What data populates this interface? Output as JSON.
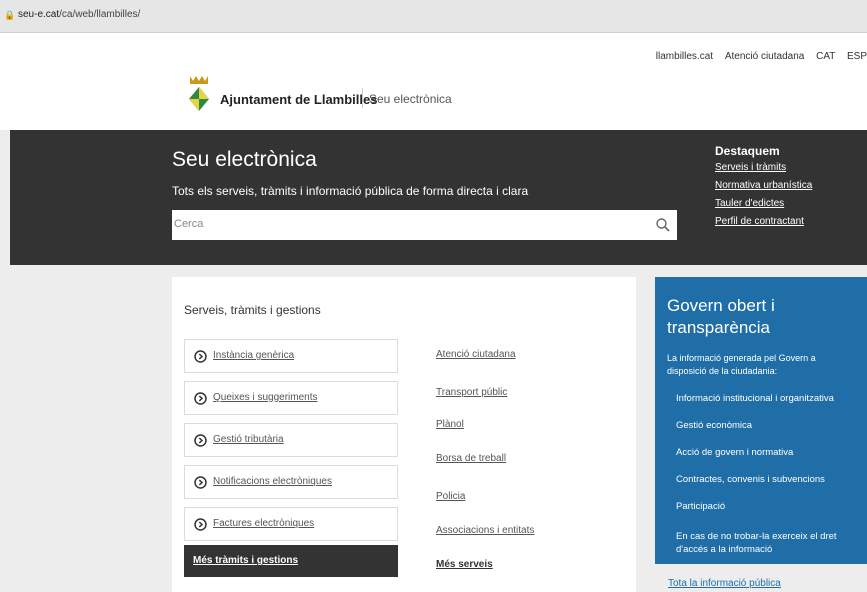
{
  "browser": {
    "url_domain": "seu-e.cat",
    "url_path": "/ca/web/llambilles/"
  },
  "top_links": [
    "llambilles.cat",
    "Atenció ciutadana",
    "CAT",
    "ESP"
  ],
  "site": {
    "name": "Ajuntament de Llambilles",
    "subtitle": "Seu electrònica"
  },
  "hero": {
    "title": "Seu electrònica",
    "subtitle": "Tots els serveis, tràmits i informació pública de forma directa i clara",
    "search_placeholder": "Cerca"
  },
  "destaquem": {
    "title": "Destaquem",
    "links": [
      "Serveis i tràmits",
      "Normativa urbanística",
      "Tauler d'edictes",
      "Perfil de contractant"
    ]
  },
  "services": {
    "title": "Serveis, tràmits i gestions",
    "items": [
      "Instància genèrica",
      "Queixes i suggeriments",
      "Gestió tributària",
      "Notificacions electròniques",
      "Factures electròniques"
    ],
    "more_label": "Més tràmits i gestions",
    "links": [
      "Atenció ciutadana",
      "Transport públic",
      "Plànol",
      "Borsa de treball",
      "Policia",
      "Associacions i entitats"
    ],
    "more_links_label": "Més serveis"
  },
  "govern": {
    "title": "Govern obert i transparència",
    "description": "La informació generada pel Govern a disposició de la ciudadania:",
    "items": [
      "Informació institucional i organitzativa",
      "Gestió econòmica",
      "Acció de govern i normativa",
      "Contractes, convenis i subvencions",
      "Participació"
    ],
    "note": "En cas de no trobar-la exerceix el dret d'accés a la informació",
    "all_link": "Tota la informació pública"
  },
  "colors": {
    "dark": "#333333",
    "gov_blue": "#1f6ea8"
  }
}
